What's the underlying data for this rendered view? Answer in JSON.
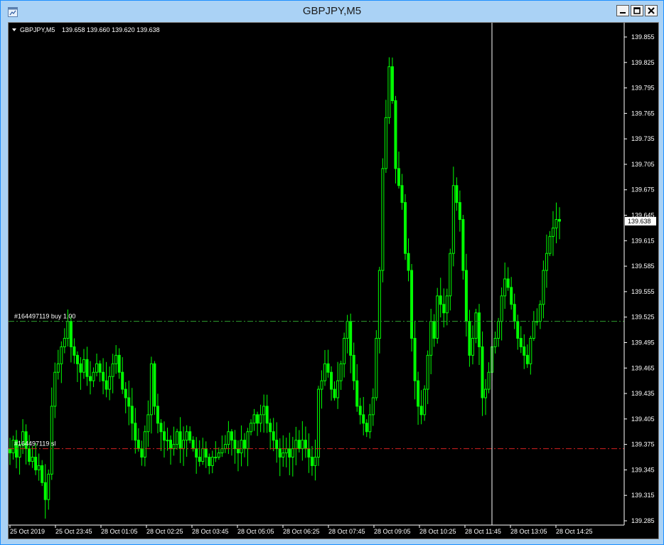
{
  "window": {
    "title": "GBPJPY,M5"
  },
  "chart_header": {
    "symbol": "GBPJPY,M5",
    "ohlc": "139.658 139.660 139.620 139.638"
  },
  "colors": {
    "background": "#000000",
    "candle": "#00ff00",
    "axis_text": "#ffffff",
    "buy_line": "#2e9e2e",
    "sl_line": "#d42020",
    "titlebar": "#aad2f5"
  },
  "orders": [
    {
      "label": "#164497119 buy 1.00",
      "price": 139.52,
      "color": "#2e9e2e"
    },
    {
      "label": "#164497119 sl",
      "price": 139.37,
      "color": "#d42020"
    }
  ],
  "current_price_label": "139.638",
  "crosshair_time_label": "28 Oct 11:45",
  "chart_data": {
    "type": "candlestick",
    "symbol": "GBPJPY",
    "timeframe": "M5",
    "ylim": [
      139.275,
      139.875
    ],
    "y_ticks": [
      "139.855",
      "139.825",
      "139.795",
      "139.765",
      "139.735",
      "139.705",
      "139.675",
      "139.645",
      "139.615",
      "139.585",
      "139.555",
      "139.525",
      "139.495",
      "139.465",
      "139.435",
      "139.405",
      "139.375",
      "139.345",
      "139.315",
      "139.285"
    ],
    "x_ticks": [
      "25 Oct 2019",
      "25 Oct 23:45",
      "28 Oct 01:05",
      "28 Oct 02:25",
      "28 Oct 03:45",
      "28 Oct 05:05",
      "28 Oct 06:25",
      "28 Oct 07:45",
      "28 Oct 09:05",
      "28 Oct 10:25",
      "28 Oct 11:45",
      "28 Oct 13:05",
      "28 Oct 14:25"
    ],
    "last_close": 139.638,
    "close_series": [
      139.365,
      139.38,
      139.36,
      139.375,
      139.39,
      139.37,
      139.355,
      139.36,
      139.345,
      139.35,
      139.33,
      139.31,
      139.34,
      139.42,
      139.46,
      139.47,
      139.49,
      139.5,
      139.52,
      139.49,
      139.48,
      139.47,
      139.46,
      139.475,
      139.455,
      139.45,
      139.46,
      139.47,
      139.46,
      139.45,
      139.44,
      139.455,
      139.47,
      139.48,
      139.46,
      139.44,
      139.43,
      139.42,
      139.4,
      139.38,
      139.37,
      139.36,
      139.39,
      139.41,
      139.47,
      139.42,
      139.4,
      139.39,
      139.38,
      139.38,
      139.37,
      139.375,
      139.39,
      139.37,
      139.38,
      139.39,
      139.38,
      139.37,
      139.36,
      139.355,
      139.37,
      139.36,
      139.35,
      139.36,
      139.36,
      139.365,
      139.37,
      139.375,
      139.39,
      139.38,
      139.37,
      139.365,
      139.38,
      139.37,
      139.39,
      139.4,
      139.41,
      139.4,
      139.41,
      139.42,
      139.4,
      139.39,
      139.38,
      139.37,
      139.36,
      139.365,
      139.37,
      139.36,
      139.37,
      139.38,
      139.37,
      139.38,
      139.37,
      139.36,
      139.35,
      139.36,
      139.44,
      139.45,
      139.47,
      139.46,
      139.44,
      139.43,
      139.45,
      139.47,
      139.5,
      139.52,
      139.48,
      139.45,
      139.42,
      139.41,
      139.4,
      139.39,
      139.41,
      139.43,
      139.5,
      139.58,
      139.7,
      139.76,
      139.82,
      139.78,
      139.7,
      139.68,
      139.66,
      139.6,
      139.58,
      139.5,
      139.45,
      139.42,
      139.41,
      139.44,
      139.48,
      139.52,
      139.5,
      139.55,
      139.54,
      139.53,
      139.55,
      139.6,
      139.68,
      139.66,
      139.64,
      139.58,
      139.52,
      139.48,
      139.5,
      139.53,
      139.49,
      139.43,
      139.44,
      139.46,
      139.49,
      139.5,
      139.52,
      139.55,
      139.57,
      139.56,
      139.54,
      139.52,
      139.5,
      139.49,
      139.48,
      139.47,
      139.5,
      139.52,
      139.52,
      139.54,
      139.58,
      139.6,
      139.62,
      139.63,
      139.64,
      139.638
    ]
  }
}
